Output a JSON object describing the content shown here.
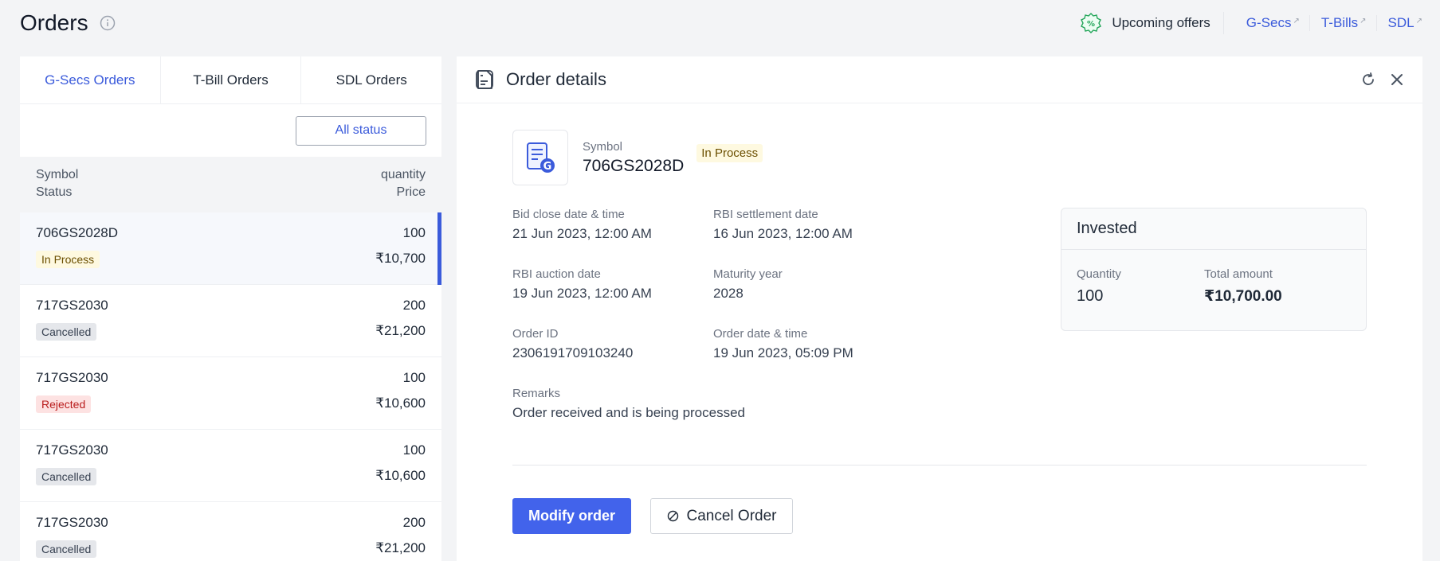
{
  "header": {
    "title": "Orders",
    "upcoming_offers": "Upcoming offers",
    "links": [
      "G-Secs",
      "T-Bills",
      "SDL"
    ]
  },
  "tabs": [
    "G-Secs Orders",
    "T-Bill Orders",
    "SDL Orders"
  ],
  "filter": {
    "status": "All status"
  },
  "list_header": {
    "symbol": "Symbol",
    "status": "Status",
    "quantity": "quantity",
    "price": "Price"
  },
  "orders": [
    {
      "symbol": "706GS2028D",
      "status": "In Process",
      "quantity": "100",
      "price": "₹10,700"
    },
    {
      "symbol": "717GS2030",
      "status": "Cancelled",
      "quantity": "200",
      "price": "₹21,200"
    },
    {
      "symbol": "717GS2030",
      "status": "Rejected",
      "quantity": "100",
      "price": "₹10,600"
    },
    {
      "symbol": "717GS2030",
      "status": "Cancelled",
      "quantity": "100",
      "price": "₹10,600"
    },
    {
      "symbol": "717GS2030",
      "status": "Cancelled",
      "quantity": "200",
      "price": "₹21,200"
    }
  ],
  "details": {
    "title": "Order details",
    "symbol_label": "Symbol",
    "symbol": "706GS2028D",
    "status": "In Process",
    "bid_close_label": "Bid close date & time",
    "bid_close": "21 Jun 2023, 12:00 AM",
    "settlement_label": "RBI settlement date",
    "settlement": "16 Jun 2023, 12:00 AM",
    "auction_label": "RBI auction date",
    "auction": "19 Jun 2023, 12:00 AM",
    "maturity_label": "Maturity year",
    "maturity": "2028",
    "order_id_label": "Order ID",
    "order_id": "2306191709103240",
    "order_date_label": "Order date & time",
    "order_date": "19 Jun 2023, 05:09 PM",
    "remarks_label": "Remarks",
    "remarks": "Order received and is being processed",
    "invested": {
      "title": "Invested",
      "quantity_label": "Quantity",
      "quantity": "100",
      "total_label": "Total amount",
      "total": "₹10,700.00"
    },
    "modify_label": "Modify order",
    "cancel_label": "Cancel Order"
  }
}
